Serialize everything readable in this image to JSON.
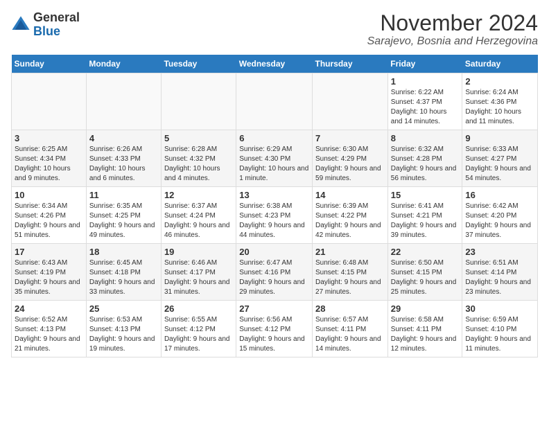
{
  "logo": {
    "general": "General",
    "blue": "Blue"
  },
  "title": "November 2024",
  "location": "Sarajevo, Bosnia and Herzegovina",
  "days_of_week": [
    "Sunday",
    "Monday",
    "Tuesday",
    "Wednesday",
    "Thursday",
    "Friday",
    "Saturday"
  ],
  "weeks": [
    [
      {
        "day": "",
        "info": ""
      },
      {
        "day": "",
        "info": ""
      },
      {
        "day": "",
        "info": ""
      },
      {
        "day": "",
        "info": ""
      },
      {
        "day": "",
        "info": ""
      },
      {
        "day": "1",
        "info": "Sunrise: 6:22 AM\nSunset: 4:37 PM\nDaylight: 10 hours and 14 minutes."
      },
      {
        "day": "2",
        "info": "Sunrise: 6:24 AM\nSunset: 4:36 PM\nDaylight: 10 hours and 11 minutes."
      }
    ],
    [
      {
        "day": "3",
        "info": "Sunrise: 6:25 AM\nSunset: 4:34 PM\nDaylight: 10 hours and 9 minutes."
      },
      {
        "day": "4",
        "info": "Sunrise: 6:26 AM\nSunset: 4:33 PM\nDaylight: 10 hours and 6 minutes."
      },
      {
        "day": "5",
        "info": "Sunrise: 6:28 AM\nSunset: 4:32 PM\nDaylight: 10 hours and 4 minutes."
      },
      {
        "day": "6",
        "info": "Sunrise: 6:29 AM\nSunset: 4:30 PM\nDaylight: 10 hours and 1 minute."
      },
      {
        "day": "7",
        "info": "Sunrise: 6:30 AM\nSunset: 4:29 PM\nDaylight: 9 hours and 59 minutes."
      },
      {
        "day": "8",
        "info": "Sunrise: 6:32 AM\nSunset: 4:28 PM\nDaylight: 9 hours and 56 minutes."
      },
      {
        "day": "9",
        "info": "Sunrise: 6:33 AM\nSunset: 4:27 PM\nDaylight: 9 hours and 54 minutes."
      }
    ],
    [
      {
        "day": "10",
        "info": "Sunrise: 6:34 AM\nSunset: 4:26 PM\nDaylight: 9 hours and 51 minutes."
      },
      {
        "day": "11",
        "info": "Sunrise: 6:35 AM\nSunset: 4:25 PM\nDaylight: 9 hours and 49 minutes."
      },
      {
        "day": "12",
        "info": "Sunrise: 6:37 AM\nSunset: 4:24 PM\nDaylight: 9 hours and 46 minutes."
      },
      {
        "day": "13",
        "info": "Sunrise: 6:38 AM\nSunset: 4:23 PM\nDaylight: 9 hours and 44 minutes."
      },
      {
        "day": "14",
        "info": "Sunrise: 6:39 AM\nSunset: 4:22 PM\nDaylight: 9 hours and 42 minutes."
      },
      {
        "day": "15",
        "info": "Sunrise: 6:41 AM\nSunset: 4:21 PM\nDaylight: 9 hours and 39 minutes."
      },
      {
        "day": "16",
        "info": "Sunrise: 6:42 AM\nSunset: 4:20 PM\nDaylight: 9 hours and 37 minutes."
      }
    ],
    [
      {
        "day": "17",
        "info": "Sunrise: 6:43 AM\nSunset: 4:19 PM\nDaylight: 9 hours and 35 minutes."
      },
      {
        "day": "18",
        "info": "Sunrise: 6:45 AM\nSunset: 4:18 PM\nDaylight: 9 hours and 33 minutes."
      },
      {
        "day": "19",
        "info": "Sunrise: 6:46 AM\nSunset: 4:17 PM\nDaylight: 9 hours and 31 minutes."
      },
      {
        "day": "20",
        "info": "Sunrise: 6:47 AM\nSunset: 4:16 PM\nDaylight: 9 hours and 29 minutes."
      },
      {
        "day": "21",
        "info": "Sunrise: 6:48 AM\nSunset: 4:15 PM\nDaylight: 9 hours and 27 minutes."
      },
      {
        "day": "22",
        "info": "Sunrise: 6:50 AM\nSunset: 4:15 PM\nDaylight: 9 hours and 25 minutes."
      },
      {
        "day": "23",
        "info": "Sunrise: 6:51 AM\nSunset: 4:14 PM\nDaylight: 9 hours and 23 minutes."
      }
    ],
    [
      {
        "day": "24",
        "info": "Sunrise: 6:52 AM\nSunset: 4:13 PM\nDaylight: 9 hours and 21 minutes."
      },
      {
        "day": "25",
        "info": "Sunrise: 6:53 AM\nSunset: 4:13 PM\nDaylight: 9 hours and 19 minutes."
      },
      {
        "day": "26",
        "info": "Sunrise: 6:55 AM\nSunset: 4:12 PM\nDaylight: 9 hours and 17 minutes."
      },
      {
        "day": "27",
        "info": "Sunrise: 6:56 AM\nSunset: 4:12 PM\nDaylight: 9 hours and 15 minutes."
      },
      {
        "day": "28",
        "info": "Sunrise: 6:57 AM\nSunset: 4:11 PM\nDaylight: 9 hours and 14 minutes."
      },
      {
        "day": "29",
        "info": "Sunrise: 6:58 AM\nSunset: 4:11 PM\nDaylight: 9 hours and 12 minutes."
      },
      {
        "day": "30",
        "info": "Sunrise: 6:59 AM\nSunset: 4:10 PM\nDaylight: 9 hours and 11 minutes."
      }
    ]
  ]
}
